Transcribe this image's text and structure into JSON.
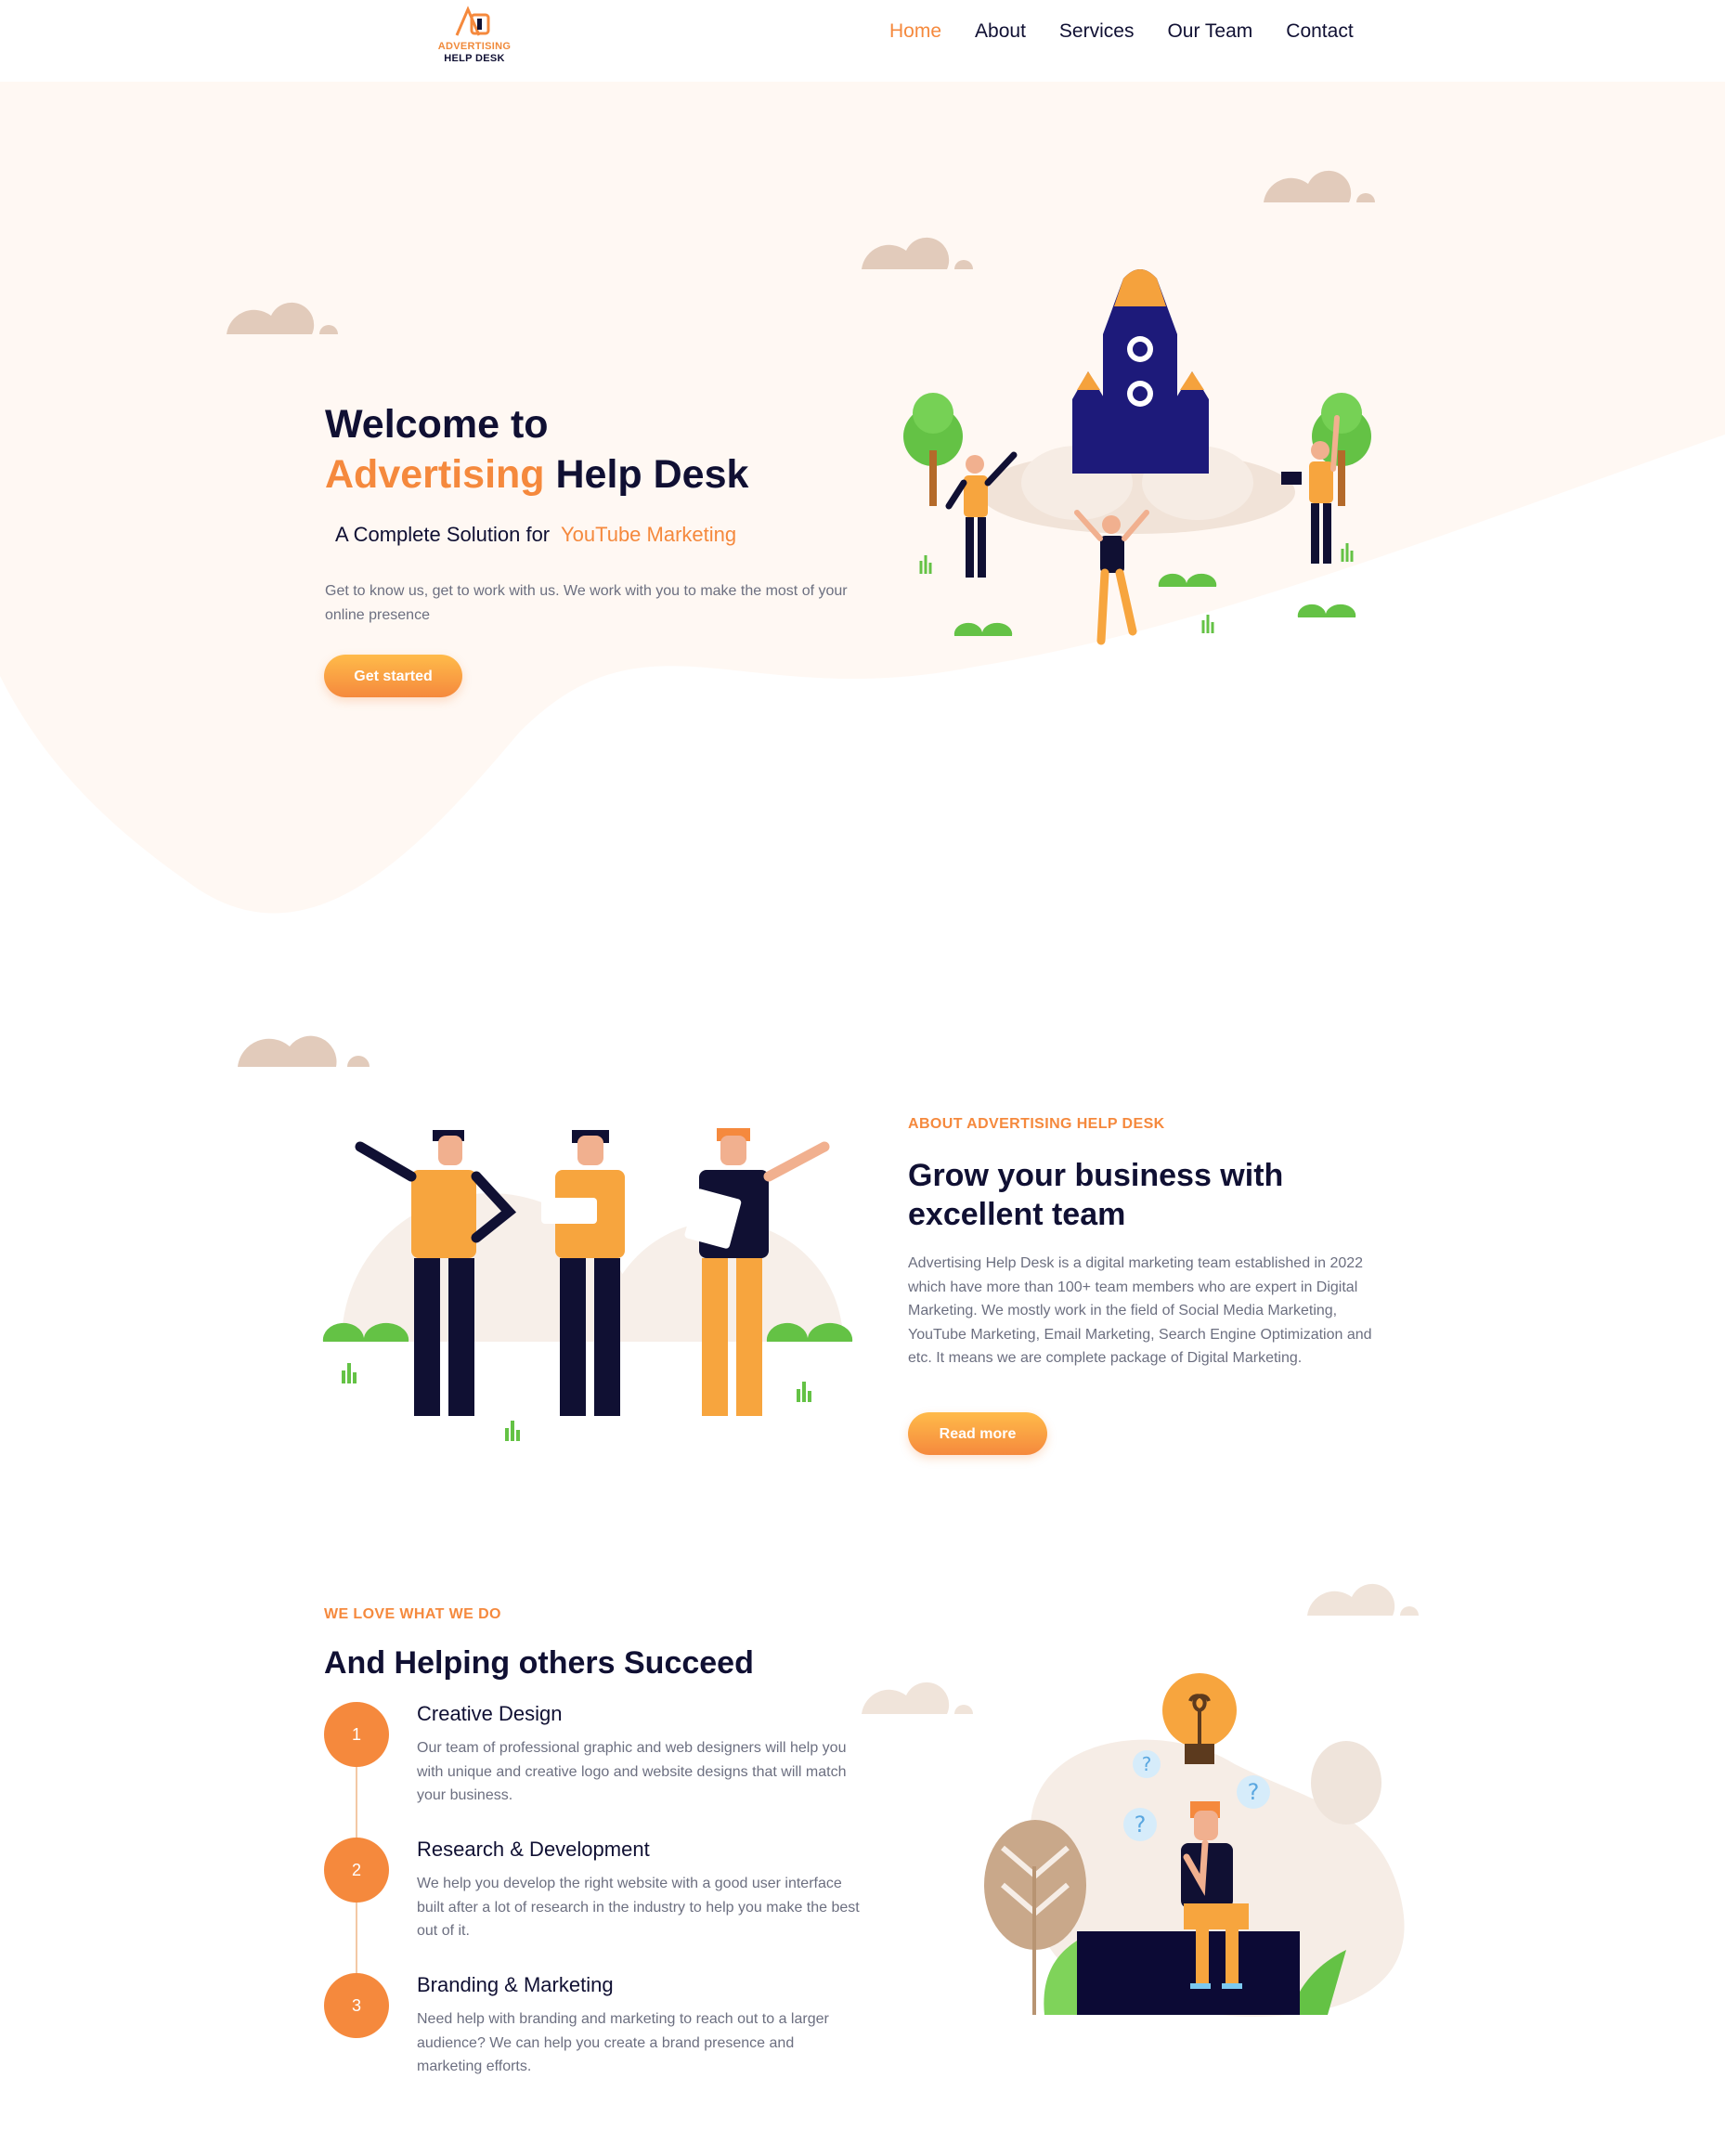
{
  "brand": {
    "line1": "ADVERTISING",
    "line2": "HELP DESK"
  },
  "nav": {
    "items": [
      {
        "label": "Home",
        "active": true
      },
      {
        "label": "About",
        "active": false
      },
      {
        "label": "Services",
        "active": false
      },
      {
        "label": "Our Team",
        "active": false
      },
      {
        "label": "Contact",
        "active": false
      }
    ]
  },
  "hero": {
    "title_line1": "Welcome to",
    "title_accent": "Advertising",
    "title_rest": "Help Desk",
    "subtitle_prefix": "A Complete Solution for",
    "subtitle_accent": "YouTube Marketing",
    "description": "Get to know us, get to work with us. We work with you to make the most of your online presence",
    "button_label": "Get started"
  },
  "about": {
    "eyebrow": "ABOUT ADVERTISING HELP DESK",
    "title": "Grow your business with excellent team",
    "description": "Advertising Help Desk is a digital marketing team established in 2022 which have more than 100+ team members who are expert in Digital Marketing. We mostly work in the field of Social Media Marketing, YouTube Marketing, Email Marketing, Search Engine Optimization and etc. It means we are complete package of Digital Marketing.",
    "button_label": "Read more"
  },
  "services": {
    "eyebrow": "WE LOVE WHAT WE DO",
    "title": "And Helping others Succeed",
    "steps": [
      {
        "number": "1",
        "title": "Creative Design",
        "description": "Our team of professional graphic and web designers will help you with unique and creative logo and website designs that will match your business."
      },
      {
        "number": "2",
        "title": "Research & Development",
        "description": "We help you develop the right website with a good user interface built after a lot of research in the industry to help you make the best out of it."
      },
      {
        "number": "3",
        "title": "Branding & Marketing",
        "description": "Need help with branding and marketing to reach out to a larger audience? We can help you create a brand presence and marketing efforts."
      }
    ]
  },
  "colors": {
    "accent": "#f5893d",
    "dark": "#101033",
    "hero_bg": "#fff8f3",
    "text_muted": "#6c6f80"
  }
}
